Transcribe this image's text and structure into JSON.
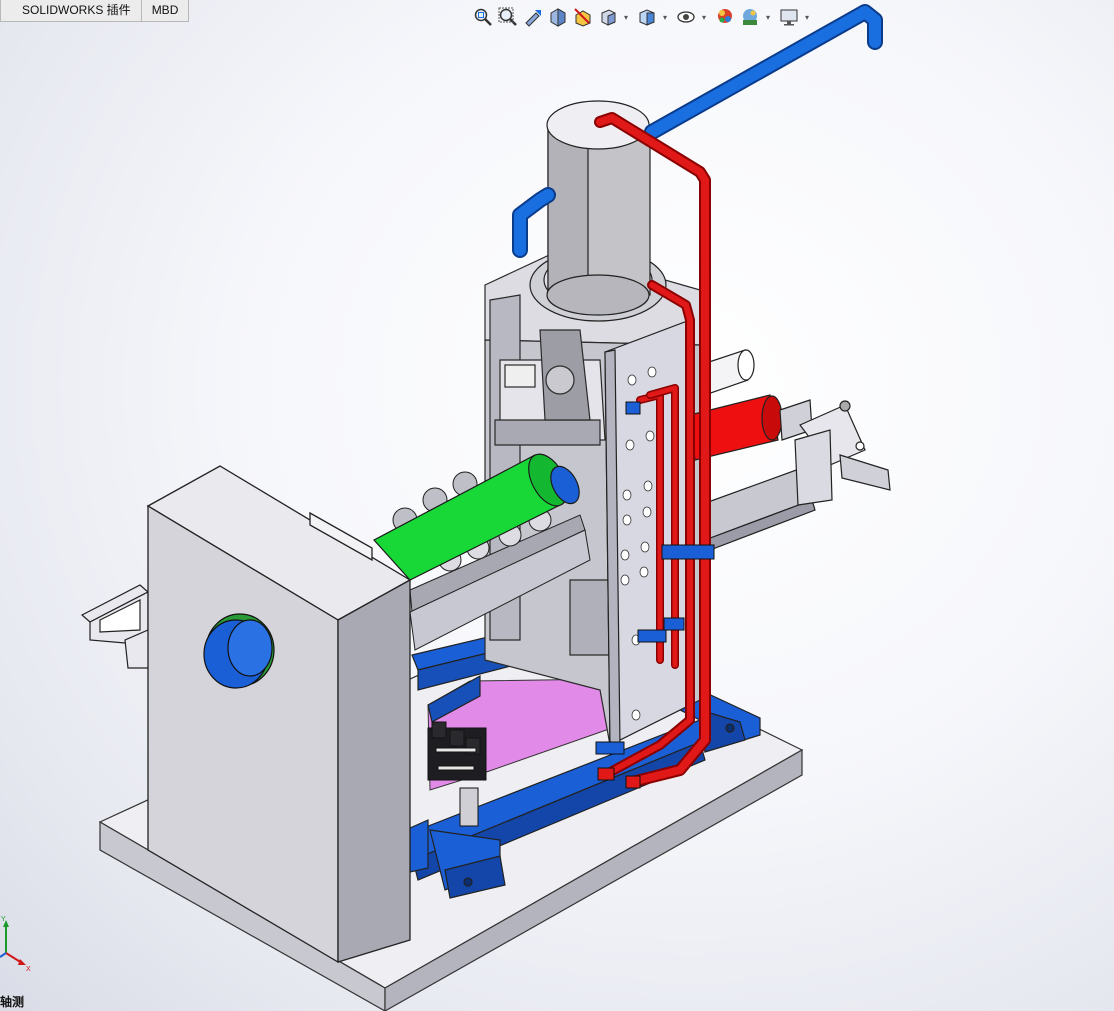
{
  "tabs": [
    {
      "label": "SOLIDWORKS 插件"
    },
    {
      "label": "MBD"
    }
  ],
  "hud_toolbar": {
    "buttons": [
      {
        "name": "zoom-to-fit-icon"
      },
      {
        "name": "zoom-to-area-icon"
      },
      {
        "name": "previous-view-icon"
      },
      {
        "name": "section-view-icon"
      },
      {
        "name": "dynamic-annotation-icon"
      },
      {
        "name": "view-orientation-icon",
        "dropdown": true
      },
      {
        "name": "display-style-icon",
        "dropdown": true
      },
      {
        "name": "hide-show-items-icon",
        "dropdown": true
      },
      {
        "name": "edit-appearance-icon"
      },
      {
        "name": "apply-scene-icon",
        "dropdown": true
      },
      {
        "name": "view-settings-icon",
        "dropdown": true
      }
    ]
  },
  "view": {
    "orientation_label": "轴测"
  },
  "triad": {
    "x_label": "X",
    "y_label": "Y"
  },
  "colors": {
    "cooling_pipe": "#1a6fe0",
    "hot_pipe": "#e01818",
    "frame_blue": "#1a5fd6",
    "drum_green": "#18d838",
    "plate_violet": "#e28ae8",
    "cylinder_red": "#ee1010",
    "housing_grey": "#d7d7dd",
    "base_plate": "#ececf0"
  }
}
